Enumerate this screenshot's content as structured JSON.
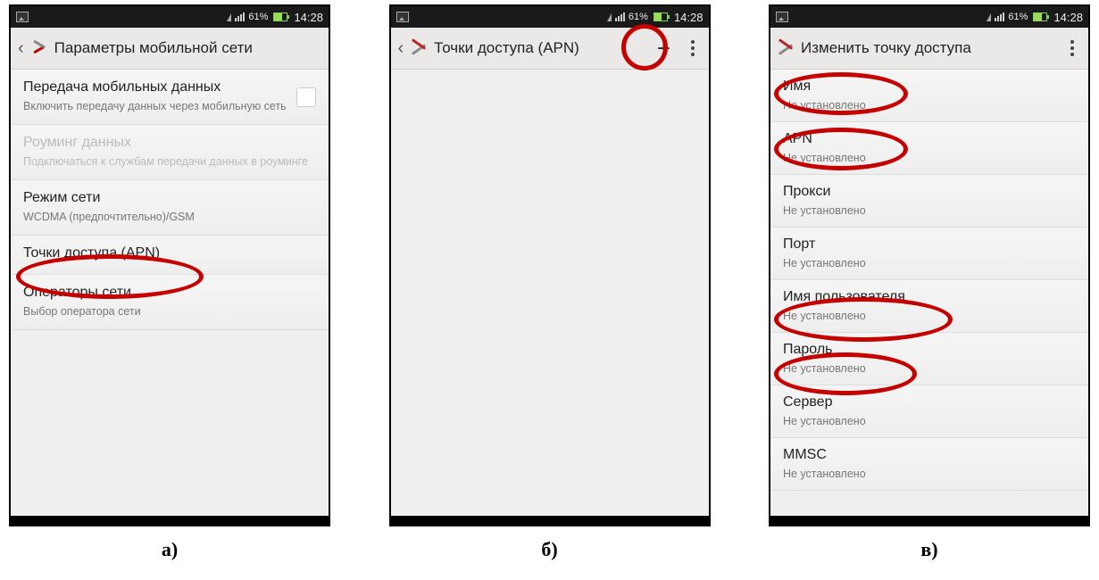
{
  "status": {
    "battery_pct": "61%",
    "time": "14:28"
  },
  "captions": {
    "a": "а)",
    "b": "б)",
    "v": "в)"
  },
  "screen_a": {
    "title": "Параметры мобильной сети",
    "items": [
      {
        "title": "Передача мобильных данных",
        "sub": "Включить передачу данных через мобильную сеть",
        "checkbox": true
      },
      {
        "title": "Роуминг данных",
        "sub": "Подключаться к службам передачи данных в роуминге",
        "disabled": true
      },
      {
        "title": "Режим сети",
        "sub": "WCDMA (предпочтительно)/GSM"
      },
      {
        "title": "Точки доступа (APN)",
        "sub": ""
      },
      {
        "title": "Операторы сети",
        "sub": "Выбор оператора сети"
      }
    ]
  },
  "screen_b": {
    "title": "Точки доступа (APN)"
  },
  "screen_v": {
    "title": "Изменить точку доступа",
    "items": [
      {
        "title": "Имя",
        "sub": "Не установлено"
      },
      {
        "title": "APN",
        "sub": "Не установлено"
      },
      {
        "title": "Прокси",
        "sub": "Не установлено"
      },
      {
        "title": "Порт",
        "sub": "Не установлено"
      },
      {
        "title": "Имя пользователя",
        "sub": "Не установлено"
      },
      {
        "title": "Пароль",
        "sub": "Не установлено"
      },
      {
        "title": "Сервер",
        "sub": "Не установлено"
      },
      {
        "title": "MMSC",
        "sub": "Не установлено"
      }
    ]
  }
}
